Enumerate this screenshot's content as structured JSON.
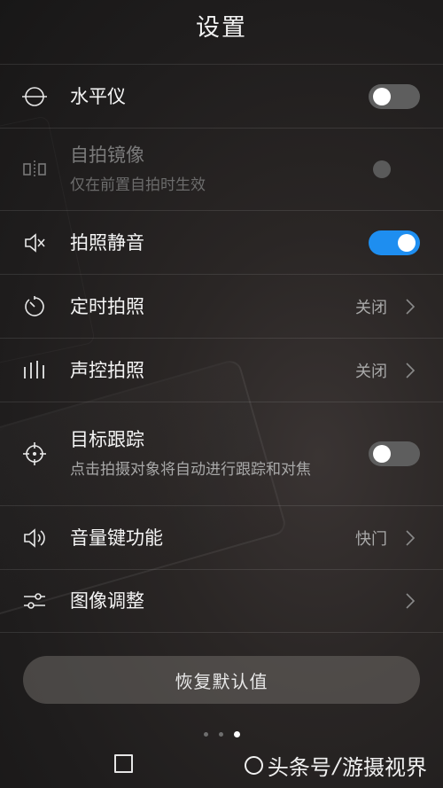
{
  "header": {
    "title": "设置"
  },
  "settings": [
    {
      "label": "水平仪",
      "control": "toggle",
      "state": "off",
      "icon": "level-icon"
    },
    {
      "label": "自拍镜像",
      "sub": "仅在前置自拍时生效",
      "control": "toggle",
      "state": "disabled",
      "icon": "mirror-icon"
    },
    {
      "label": "拍照静音",
      "control": "toggle",
      "state": "on",
      "icon": "speaker-mute-icon"
    },
    {
      "label": "定时拍照",
      "control": "value",
      "value": "关闭",
      "icon": "timer-icon"
    },
    {
      "label": "声控拍照",
      "control": "value",
      "value": "关闭",
      "icon": "audio-bars-icon"
    },
    {
      "label": "目标跟踪",
      "sub": "点击拍摄对象将自动进行跟踪和对焦",
      "control": "toggle",
      "state": "off",
      "icon": "crosshair-icon"
    },
    {
      "label": "音量键功能",
      "control": "value",
      "value": "快门",
      "icon": "speaker-icon"
    },
    {
      "label": "图像调整",
      "control": "chevron",
      "icon": "sliders-icon"
    }
  ],
  "reset_button": {
    "label": "恢复默认值"
  },
  "pager": {
    "total": 3,
    "active": 3
  },
  "watermark": {
    "brand": "头条号",
    "slash": "/",
    "name": "游摄视界"
  },
  "colors": {
    "accent": "#1e8ef0",
    "toggle_off": "#5e5e5e"
  }
}
